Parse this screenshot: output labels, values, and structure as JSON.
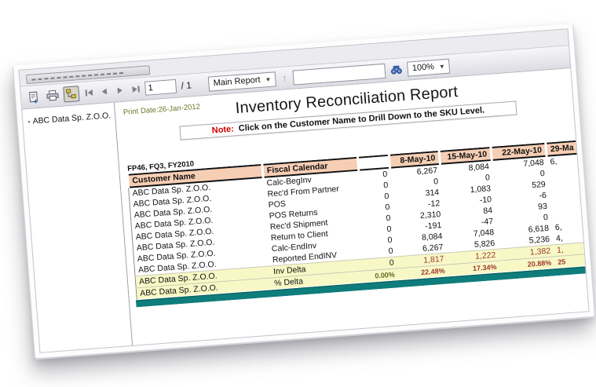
{
  "toolbar": {
    "page_number": "1",
    "page_total": "/ 1",
    "report_view": "Main Report",
    "search_value": "",
    "zoom_level": "100%",
    "caret": "▼",
    "goto_glyph": "↑",
    "icons": {
      "export": "export-icon",
      "print": "print-icon",
      "group_tree": "toggle-group-tree-icon",
      "first": "first-page-icon",
      "prev": "previous-page-icon",
      "next": "next-page-icon",
      "last": "last-page-icon",
      "goto": "go-to-icon",
      "search": "binoculars-search-icon"
    }
  },
  "sidebar": {
    "items": [
      {
        "glyph": "▪",
        "label": "ABC Data Sp. Z.O.O."
      }
    ]
  },
  "report": {
    "print_date": "Print Date:26-Jan-2012",
    "title": "Inventory Reconciliation Report",
    "note_label": "Note:",
    "note_text": "Click on the Customer Name to Drill Down to the SKU Level.",
    "period": "FP46, FQ3, FY2010",
    "table": {
      "col_headers": [
        "Customer Name",
        "Fiscal Calendar",
        "",
        "8-May-10",
        "15-May-10",
        "22-May-10",
        "29-Ma"
      ],
      "rows": [
        {
          "customer": "ABC Data Sp. Z.O.O.",
          "metric": "Calc-BegInv",
          "values": [
            "0",
            "6,267",
            "8,084",
            "7,048",
            "6,"
          ]
        },
        {
          "customer": "ABC Data Sp. Z.O.O.",
          "metric": "Rec'd From Partner",
          "values": [
            "0",
            "0",
            "0",
            "0",
            ""
          ]
        },
        {
          "customer": "ABC Data Sp. Z.O.O.",
          "metric": "POS",
          "values": [
            "0",
            "314",
            "1,083",
            "529",
            ""
          ]
        },
        {
          "customer": "ABC Data Sp. Z.O.O.",
          "metric": "POS Returns",
          "values": [
            "0",
            "-12",
            "-10",
            "-6",
            ""
          ]
        },
        {
          "customer": "ABC Data Sp. Z.O.O.",
          "metric": "Rec'd Shipment",
          "values": [
            "0",
            "2,310",
            "84",
            "93",
            ""
          ]
        },
        {
          "customer": "ABC Data Sp. Z.O.O.",
          "metric": "Return to Client",
          "values": [
            "0",
            "-191",
            "-47",
            "0",
            ""
          ]
        },
        {
          "customer": "ABC Data Sp. Z.O.O.",
          "metric": "Calc-EndInv",
          "values": [
            "0",
            "8,084",
            "7,048",
            "6,618",
            "6,"
          ]
        },
        {
          "customer": "ABC Data Sp. Z.O.O.",
          "metric": "Reported EndINV",
          "values": [
            "0",
            "6,267",
            "5,826",
            "5,236",
            "4,"
          ]
        },
        {
          "customer": "ABC Data Sp. Z.O.O.",
          "metric": "Inv Delta",
          "values": [
            "0",
            "1,817",
            "1,222",
            "1,382",
            "1,"
          ],
          "highlight": true,
          "colors": [
            "#1a1a1a",
            "#9c3b2e",
            "#9c3b2e",
            "#9c3b2e",
            "#9c3b2e"
          ]
        },
        {
          "customer": "ABC Data Sp. Z.O.O.",
          "metric": "% Delta",
          "values": [
            "0.00%",
            "22.48%",
            "17.34%",
            "20.88%",
            "25"
          ],
          "highlight": true,
          "pct": true,
          "colors": [
            "#5f6b1e",
            "#a03a2a",
            "#a03a2a",
            "#a03a2a",
            "#a03a2a"
          ]
        }
      ]
    }
  },
  "colors": {
    "header_bg": "#f6ceb4",
    "highlight_bg": "#f8f8c6",
    "teal_bar": "#0e7d7c",
    "delta_text": "#9c3b2e",
    "zero_pct_text": "#5f6b1e",
    "print_date_text": "#6b7a28",
    "note_label_red": "#cc0000"
  }
}
